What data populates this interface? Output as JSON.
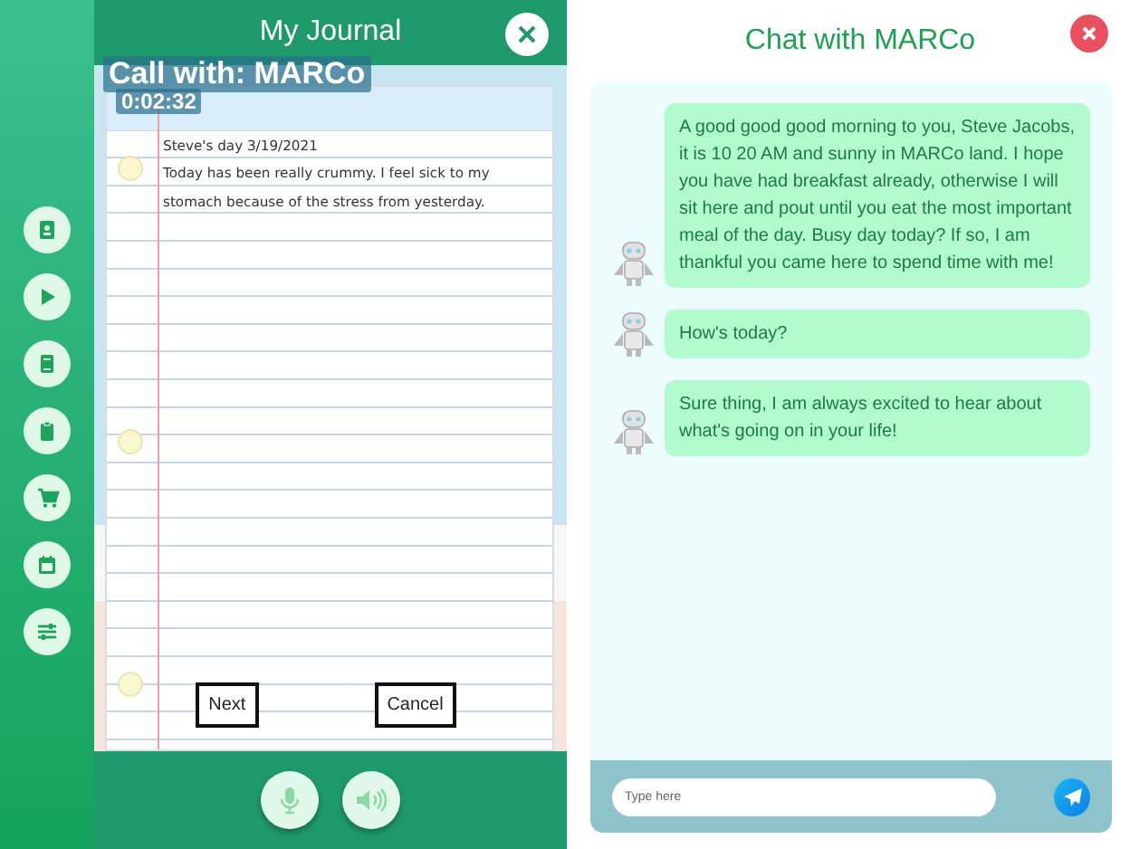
{
  "journal": {
    "title": "My Journal",
    "call_title": "Call with: MARCo",
    "call_timer": "0:02:32",
    "lines": [
      "Steve's day 3/19/2021",
      "Today has been really crummy. I feel sick to my",
      "stomach because of the stress from yesterday."
    ],
    "buttons": [
      "Next",
      "Cancel"
    ]
  },
  "chat": {
    "title": "Chat with MARCo",
    "messages": [
      {
        "text": "A good good good morning to you, Steve Jacobs, it is 10 20 AM and sunny in MARCo land. I hope you have had breakfast already, otherwise I will sit here and pout until you eat the most important meal of the day. Busy day today? If so, I am thankful you came here to spend time with me!"
      },
      {
        "text": "How's today?"
      },
      {
        "text": "Sure thing, I am always excited to hear about what's going on in your life!"
      }
    ],
    "input": {
      "placeholder": "Type here"
    }
  }
}
